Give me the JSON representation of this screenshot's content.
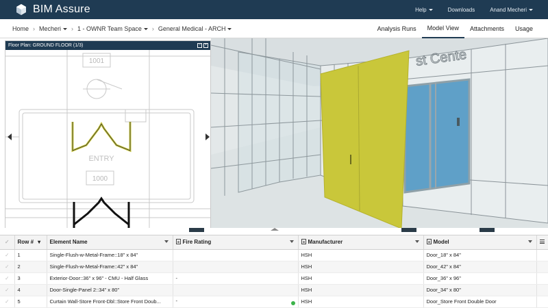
{
  "app": {
    "brand": "BIM Assure"
  },
  "topnav": {
    "help": "Help",
    "downloads": "Downloads",
    "user": "Anand Mecheri"
  },
  "breadcrumb": {
    "home": "Home",
    "items": [
      "Mecheri",
      "1 - OWNR Team Space",
      "General Medical - ARCH"
    ]
  },
  "tabs": {
    "analysis_runs": "Analysis Runs",
    "model_view": "Model View",
    "attachments": "Attachments",
    "usage": "Usage"
  },
  "floor_plan": {
    "title": "Floor Plan: GROUND FLOOR (1/3)",
    "room_numbers": [
      "1001",
      "1000"
    ],
    "room_label": "ENTRY"
  },
  "viewer": {
    "sign_text": "st Cente"
  },
  "grid": {
    "columns": [
      "Row #",
      "Element Name",
      "Fire Rating",
      "Manufacturer",
      "Model"
    ],
    "rows": [
      {
        "row": "1",
        "name": "Single-Flush-w-Metal-Frame::18\" x 84\"",
        "fire": "",
        "manufacturer": "HSH",
        "model": "Door_18\" x 84\""
      },
      {
        "row": "2",
        "name": "Single-Flush-w-Metal-Frame::42\" x 84\"",
        "fire": "",
        "manufacturer": "HSH",
        "model": "Door_42\" x 84\""
      },
      {
        "row": "3",
        "name": "Exterior-Door::36\" x 96\" - CMU - Half Glass",
        "fire": "-",
        "manufacturer": "HSH",
        "model": "Door_36\" x 96\""
      },
      {
        "row": "4",
        "name": "Door-Single-Panel 2::34\" x 80\"",
        "fire": "",
        "manufacturer": "HSH",
        "model": "Door_34\" x 80\""
      },
      {
        "row": "5",
        "name": "Curtain Wall-Store Front-Dbl::Store Front Doub...",
        "fire": "-",
        "manufacturer": "HSH",
        "model": "Door_Store Front Double Door"
      }
    ]
  },
  "colors": {
    "nav": "#1f3b53",
    "highlight_door": "#c9c73a",
    "glass": "#5fa0c8",
    "status_ok": "#3cb34a"
  }
}
